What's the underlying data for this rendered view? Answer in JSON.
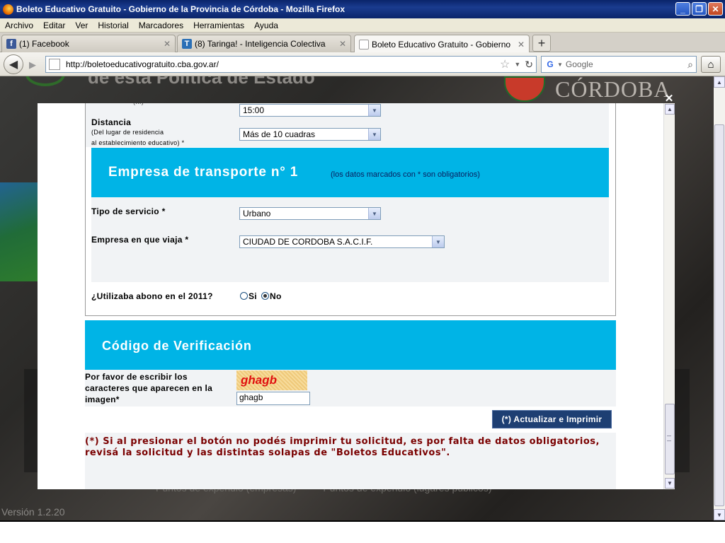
{
  "window": {
    "title": "Boleto Educativo Gratuito - Gobierno de la Provincia de Córdoba - Mozilla Firefox",
    "minimize": "_",
    "restore": "❐",
    "close": "✕"
  },
  "menu": [
    "Archivo",
    "Editar",
    "Ver",
    "Historial",
    "Marcadores",
    "Herramientas",
    "Ayuda"
  ],
  "tabs": [
    {
      "label": "(1) Facebook",
      "icon": "f"
    },
    {
      "label": "(8) Taringa! - Inteligencia Colectiva",
      "icon": "T"
    },
    {
      "label": "Boleto Educativo Gratuito - Gobierno de la...",
      "icon": ""
    }
  ],
  "newtab": "+",
  "nav": {
    "url": "http://boletoeducativogratuito.cba.gov.ar/",
    "search_placeholder": "Google",
    "search_engine_icon": "G"
  },
  "background": {
    "heading": "de esta Política de Estado",
    "brand": "CÓRDOBA",
    "footer_links": [
      "Puntos de expendio (empresas)",
      "Puntos de expendio (lugares públicos)"
    ],
    "version": "Versión 1.2.20"
  },
  "form": {
    "top_partial_label": "(...)",
    "time_value": "15:00",
    "distance_label": "Distancia",
    "distance_sub1": "(Del lugar de residencia",
    "distance_sub2": "al establecimiento educativo)",
    "required_mark": "*",
    "distance_value": "Más de 10 cuadras",
    "transport_title": "Empresa de transporte n° 1",
    "transport_note": "(los datos marcados con * son obligatorios)",
    "service_label": "Tipo de servicio *",
    "service_value": "Urbano",
    "company_label": "Empresa en que viaja *",
    "company_value": "CIUDAD DE CORDOBA S.A.C.I.F.",
    "abono_label": "¿Utilizaba abono en el 2011?",
    "abono_si": "Si",
    "abono_no": "No",
    "abono_selected": "No"
  },
  "verification": {
    "title": "Código de Verificación",
    "prompt_line1": "Por favor de escribir los",
    "prompt_line2": "caracteres que aparecen en la",
    "prompt_line3": "imagen*",
    "captcha_text": "ghagb",
    "input_value": "ghagb",
    "button_label": "(*) Actualizar e Imprimir",
    "warning_line1": "(*) Si al presionar el botón no podés imprimir tu solicitud, es por falta de datos obligatorios,",
    "warning_line2": "revisá la solicitud y las distintas solapas de \"Boletos Educativos\"."
  },
  "colors": {
    "banner": "#00b4e6",
    "button": "#1e3f73",
    "warning": "#7a0000",
    "captcha": "#e01010"
  }
}
